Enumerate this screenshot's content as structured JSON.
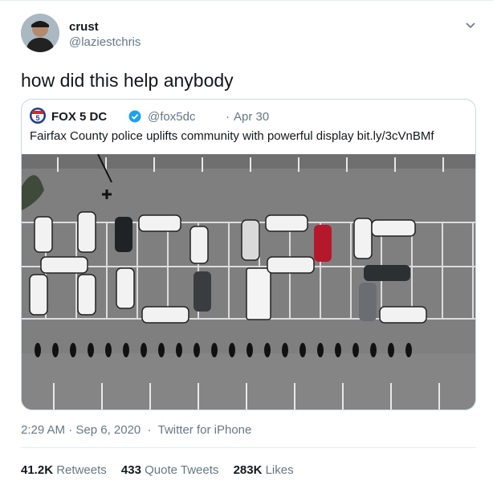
{
  "tweet": {
    "author": {
      "name": "crust",
      "handle": "@laziestchris"
    },
    "text": "how did this help anybody",
    "timestamp": "2:29 AM · Sep 6, 2020",
    "separator": "·",
    "source": "Twitter for iPhone",
    "stats": [
      {
        "count": "41.2K",
        "label": "Retweets"
      },
      {
        "count": "433",
        "label": "Quote Tweets"
      },
      {
        "count": "283K",
        "label": "Likes"
      }
    ]
  },
  "quote": {
    "author": {
      "name": "FOX 5 DC",
      "handle": "@fox5dc",
      "verified": true
    },
    "separator": "·",
    "date": "Apr 30",
    "text": "Fairfax County police uplifts community with powerful display bit.ly/3cVnBMf"
  },
  "icons": {
    "menu": "chevron-down-icon",
    "verified": "verified-badge-icon",
    "brand": "fox5-logo"
  },
  "colors": {
    "text": "#14171a",
    "secondary": "#657786",
    "border": "#ccd6dd",
    "verified": "#1da1f2"
  }
}
